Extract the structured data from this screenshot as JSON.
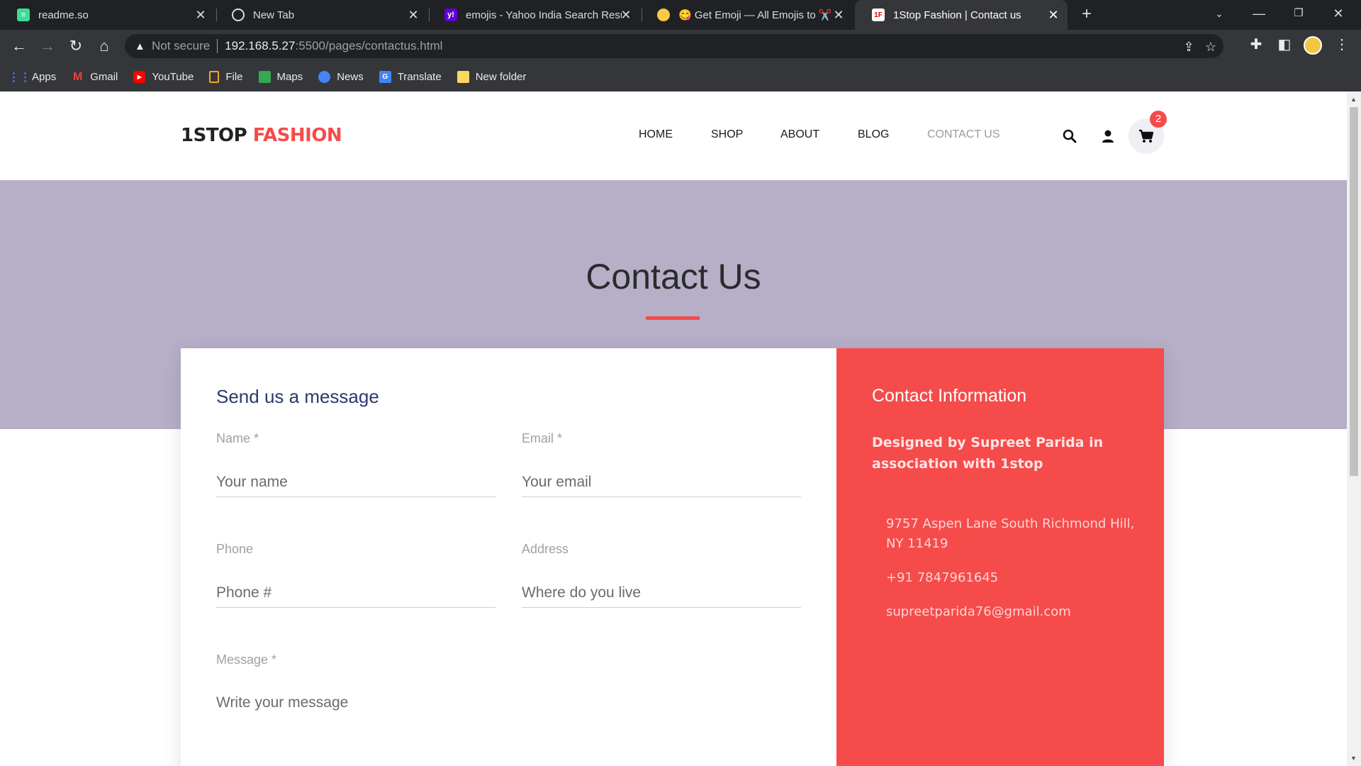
{
  "browser": {
    "tabs": [
      {
        "title": "readme.so",
        "favicon": "readme-icon",
        "active": false
      },
      {
        "title": "New Tab",
        "favicon": "globe-icon",
        "active": false
      },
      {
        "title": "emojis - Yahoo India Search Resu",
        "favicon": "yahoo-icon",
        "active": false
      },
      {
        "title": "😋 Get Emoji — All Emojis to ✂️",
        "favicon": "emoji-icon",
        "active": false
      },
      {
        "title": "1Stop Fashion | Contact us",
        "favicon": "1f-icon",
        "active": true
      }
    ],
    "address": {
      "security": "Not secure",
      "host": "192.168.5.27",
      "path": ":5500/pages/contactus.html"
    },
    "bookmarks": [
      {
        "label": "Apps",
        "icon": "apps-grid-icon"
      },
      {
        "label": "Gmail",
        "icon": "gmail-icon"
      },
      {
        "label": "YouTube",
        "icon": "youtube-icon"
      },
      {
        "label": "File",
        "icon": "file-icon"
      },
      {
        "label": "Maps",
        "icon": "maps-icon"
      },
      {
        "label": "News",
        "icon": "news-icon"
      },
      {
        "label": "Translate",
        "icon": "translate-icon"
      },
      {
        "label": "New folder",
        "icon": "folder-icon"
      }
    ]
  },
  "site": {
    "logo_part1": "1STOP",
    "logo_part2": " FASHION",
    "nav": [
      "HOME",
      "SHOP",
      "ABOUT",
      "BLOG",
      "CONTACT US"
    ],
    "active_nav": "CONTACT US",
    "cart_count": "2",
    "colors": {
      "accent": "#f54b4b",
      "hero": "#b6afc7",
      "heading": "#2b3a6b"
    }
  },
  "hero": {
    "title": "Contact Us"
  },
  "form": {
    "title": "Send us a message",
    "fields": {
      "name": {
        "label": "Name *",
        "placeholder": "Your name"
      },
      "email": {
        "label": "Email *",
        "placeholder": "Your email"
      },
      "phone": {
        "label": "Phone",
        "placeholder": "Phone #"
      },
      "address": {
        "label": "Address",
        "placeholder": "Where do you live"
      },
      "message": {
        "label": "Message *",
        "placeholder": "Write your message"
      }
    }
  },
  "info": {
    "title": "Contact Information",
    "description": "Designed by Supreet Parida in association with 1stop",
    "address": "9757 Aspen Lane South Richmond Hill, NY 11419",
    "phone": "+91 7847961645",
    "email": "supreetparida76@gmail.com"
  }
}
